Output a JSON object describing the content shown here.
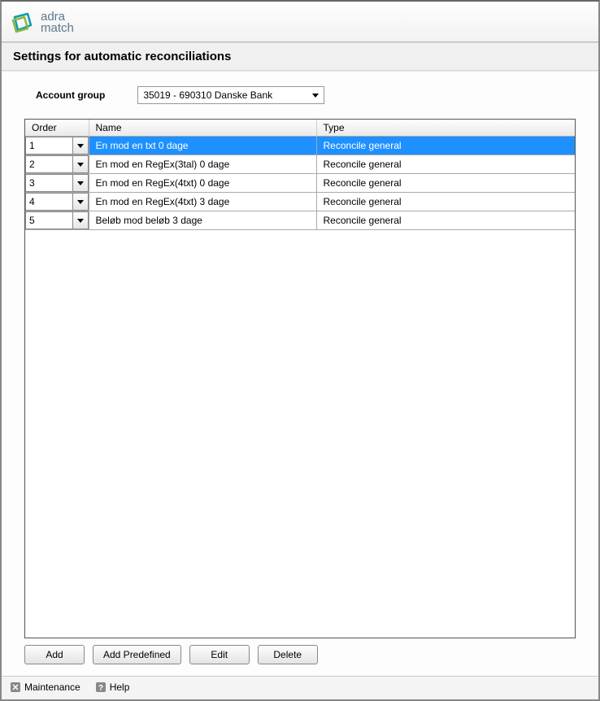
{
  "brand": {
    "line1": "adra",
    "line2": "match"
  },
  "page_title": "Settings for automatic reconciliations",
  "account_group": {
    "label": "Account group",
    "selected": "35019 - 690310 Danske Bank"
  },
  "table": {
    "columns": {
      "order": "Order",
      "name": "Name",
      "type": "Type"
    },
    "rows": [
      {
        "order": "1",
        "name": "En mod en txt 0 dage",
        "type": "Reconcile general",
        "selected": true
      },
      {
        "order": "2",
        "name": "En mod en RegEx(3tal) 0 dage",
        "type": "Reconcile general",
        "selected": false
      },
      {
        "order": "3",
        "name": "En mod en RegEx(4txt) 0 dage",
        "type": "Reconcile general",
        "selected": false
      },
      {
        "order": "4",
        "name": "En mod en RegEx(4txt) 3 dage",
        "type": "Reconcile general",
        "selected": false
      },
      {
        "order": "5",
        "name": "Beløb mod beløb 3 dage",
        "type": "Reconcile general",
        "selected": false
      }
    ]
  },
  "buttons": {
    "add": "Add",
    "add_predefined": "Add Predefined",
    "edit": "Edit",
    "delete": "Delete"
  },
  "statusbar": {
    "maintenance": "Maintenance",
    "help": "Help"
  }
}
